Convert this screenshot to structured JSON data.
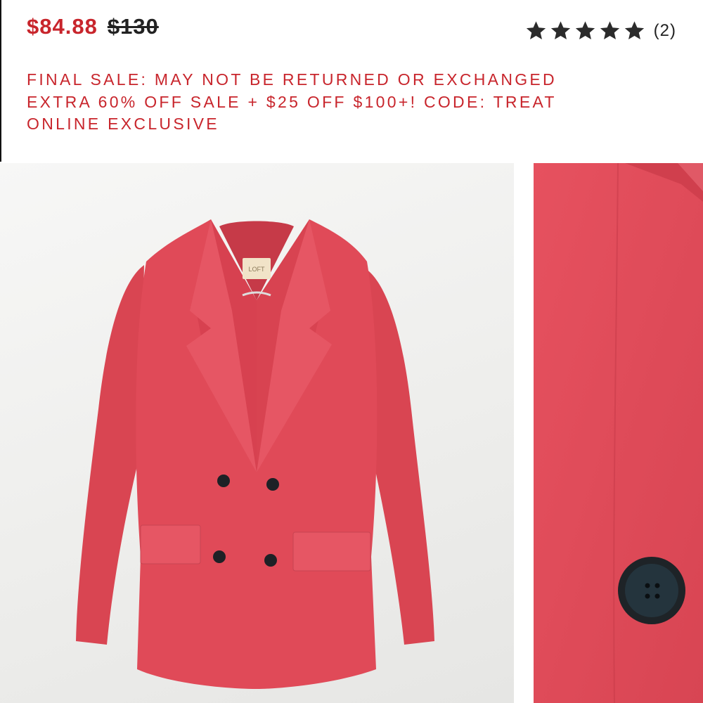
{
  "price": {
    "sale": "$84.88",
    "original": "$130"
  },
  "rating": {
    "stars": 5,
    "max_stars": 5,
    "count_label": "(2)"
  },
  "promo": {
    "lines": [
      "FINAL SALE: MAY NOT BE RETURNED OR EXCHANGED",
      "EXTRA 60% OFF SALE + $25 OFF $100+! CODE: TREAT",
      "ONLINE EXCLUSIVE"
    ]
  },
  "images": {
    "main_label_text": "LOFT",
    "product_color": "#e04a58",
    "accent_red": "#c8252c"
  }
}
